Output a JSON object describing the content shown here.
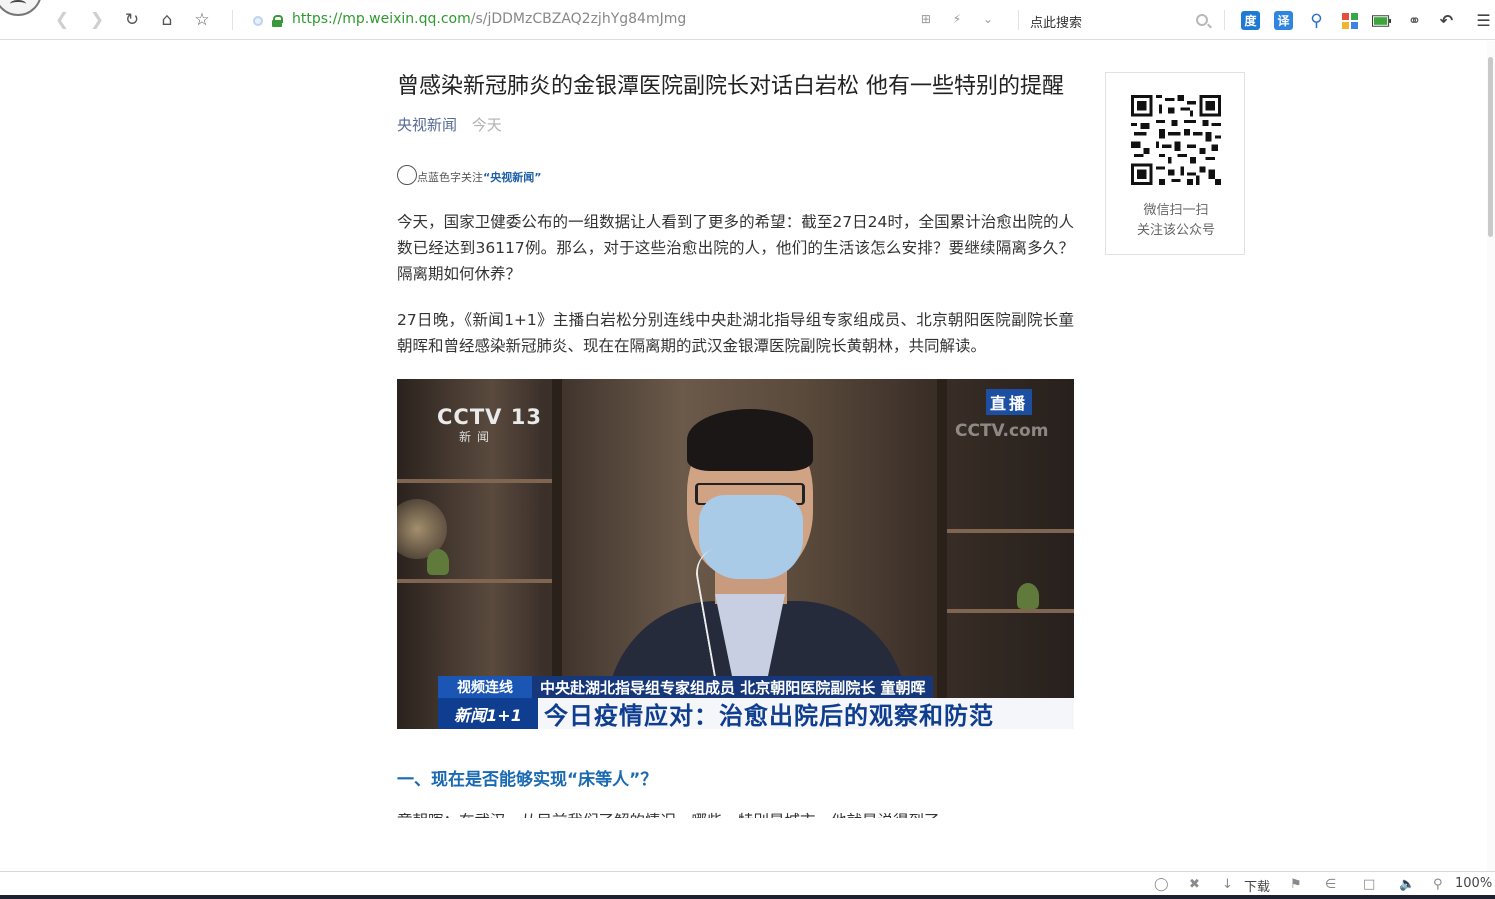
{
  "browser": {
    "url_scheme": "https://",
    "url_host": "mp.weixin.qq.com",
    "url_path": "/s/jDDMzCBZAQ2zjhYg84mJmg",
    "search_placeholder": "点此搜索",
    "url_tools": "⊞ ⚡ ⌄"
  },
  "article": {
    "title": "曾感染新冠肺炎的金银潭医院副院长对话白岩松 他有一些特别的提醒",
    "source": "央视新闻",
    "date": "今天",
    "follow_prefix": "点蓝色字关注",
    "follow_name": "“央视新闻”",
    "paragraphs": [
      "今天，国家卫健委公布的一组数据让人看到了更多的希望：截至27日24时，全国累计治愈出院的人数已经达到36117例。那么，对于这些治愈出院的人，他们的生活该怎么安排？要继续隔离多久？隔离期如何休养？",
      "27日晚，《新闻1+1》主播白岩松分别连线中央赴湖北指导组专家组成员、北京朝阳医院副院长童朝晖和曾经感染新冠肺炎、现在在隔离期的武汉金银潭医院副院长黄朝林，共同解读。"
    ],
    "video": {
      "channel_logo": "CCTV 13",
      "channel_sub": "新闻",
      "live_badge": "直播",
      "watermark": "CCTV.com",
      "caption_tag": "视频连线",
      "caption_text": "中央赴湖北指导组专家组成员 北京朝阳医院副院长 童朝晖",
      "program_brand": "新闻1+1",
      "program_title": "今日疫情应对：治愈出院后的观察和防范"
    },
    "section_heading": "一、现在是否能够实现“床等人”？",
    "cut_paragraph": "童朝晖：在武汉，从目前我们了解的情况，哪些，特别是城市，他就是说得到了"
  },
  "qr_card": {
    "line1": "微信扫一扫",
    "line2": "关注该公众号"
  },
  "statusbar": {
    "download_label": "下载",
    "zoom": "100%"
  },
  "colors": {
    "link_blue": "#576b95",
    "section_blue": "#1a6ab3",
    "url_green": "#2e9a2e"
  }
}
